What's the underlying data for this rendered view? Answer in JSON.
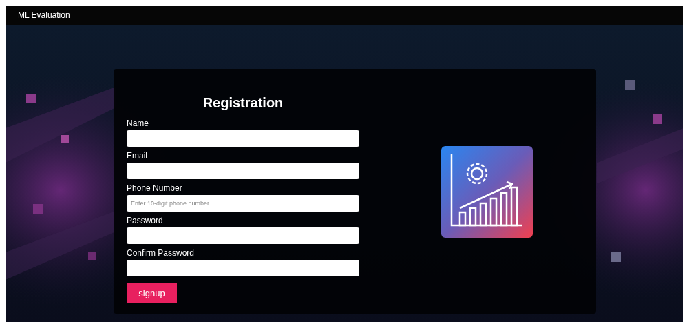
{
  "navbar": {
    "brand": "ML Evaluation"
  },
  "form": {
    "title": "Registration",
    "fields": [
      {
        "label": "Name"
      },
      {
        "label": "Email"
      },
      {
        "label": "Phone Number",
        "placeholder": "Enter 10-digit phone number"
      },
      {
        "label": "Password"
      },
      {
        "label": "Confirm Password"
      }
    ],
    "submit": "signup"
  }
}
